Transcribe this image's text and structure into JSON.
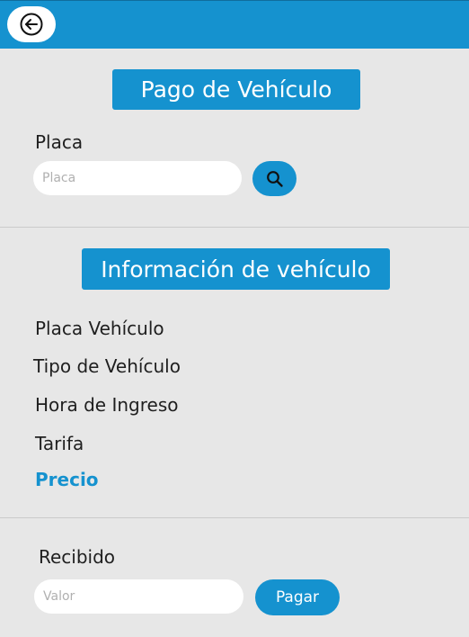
{
  "header": {
    "back_icon": "arrow-left-circle-icon"
  },
  "payment": {
    "title": "Pago de Vehículo",
    "plate_label": "Placa",
    "plate_placeholder": "Placa",
    "search_icon": "search-icon"
  },
  "vehicle_info": {
    "title": "Información de vehículo",
    "fields": [
      "Placa Vehículo",
      "Tipo de Vehículo",
      "Hora de Ingreso",
      "Tarifa",
      "Precio"
    ]
  },
  "received": {
    "label": "Recibido",
    "value_placeholder": "Valor",
    "pay_label": "Pagar"
  },
  "colors": {
    "accent": "#1592cf",
    "background": "#e7e7e7",
    "price_text": "#1592cf"
  }
}
